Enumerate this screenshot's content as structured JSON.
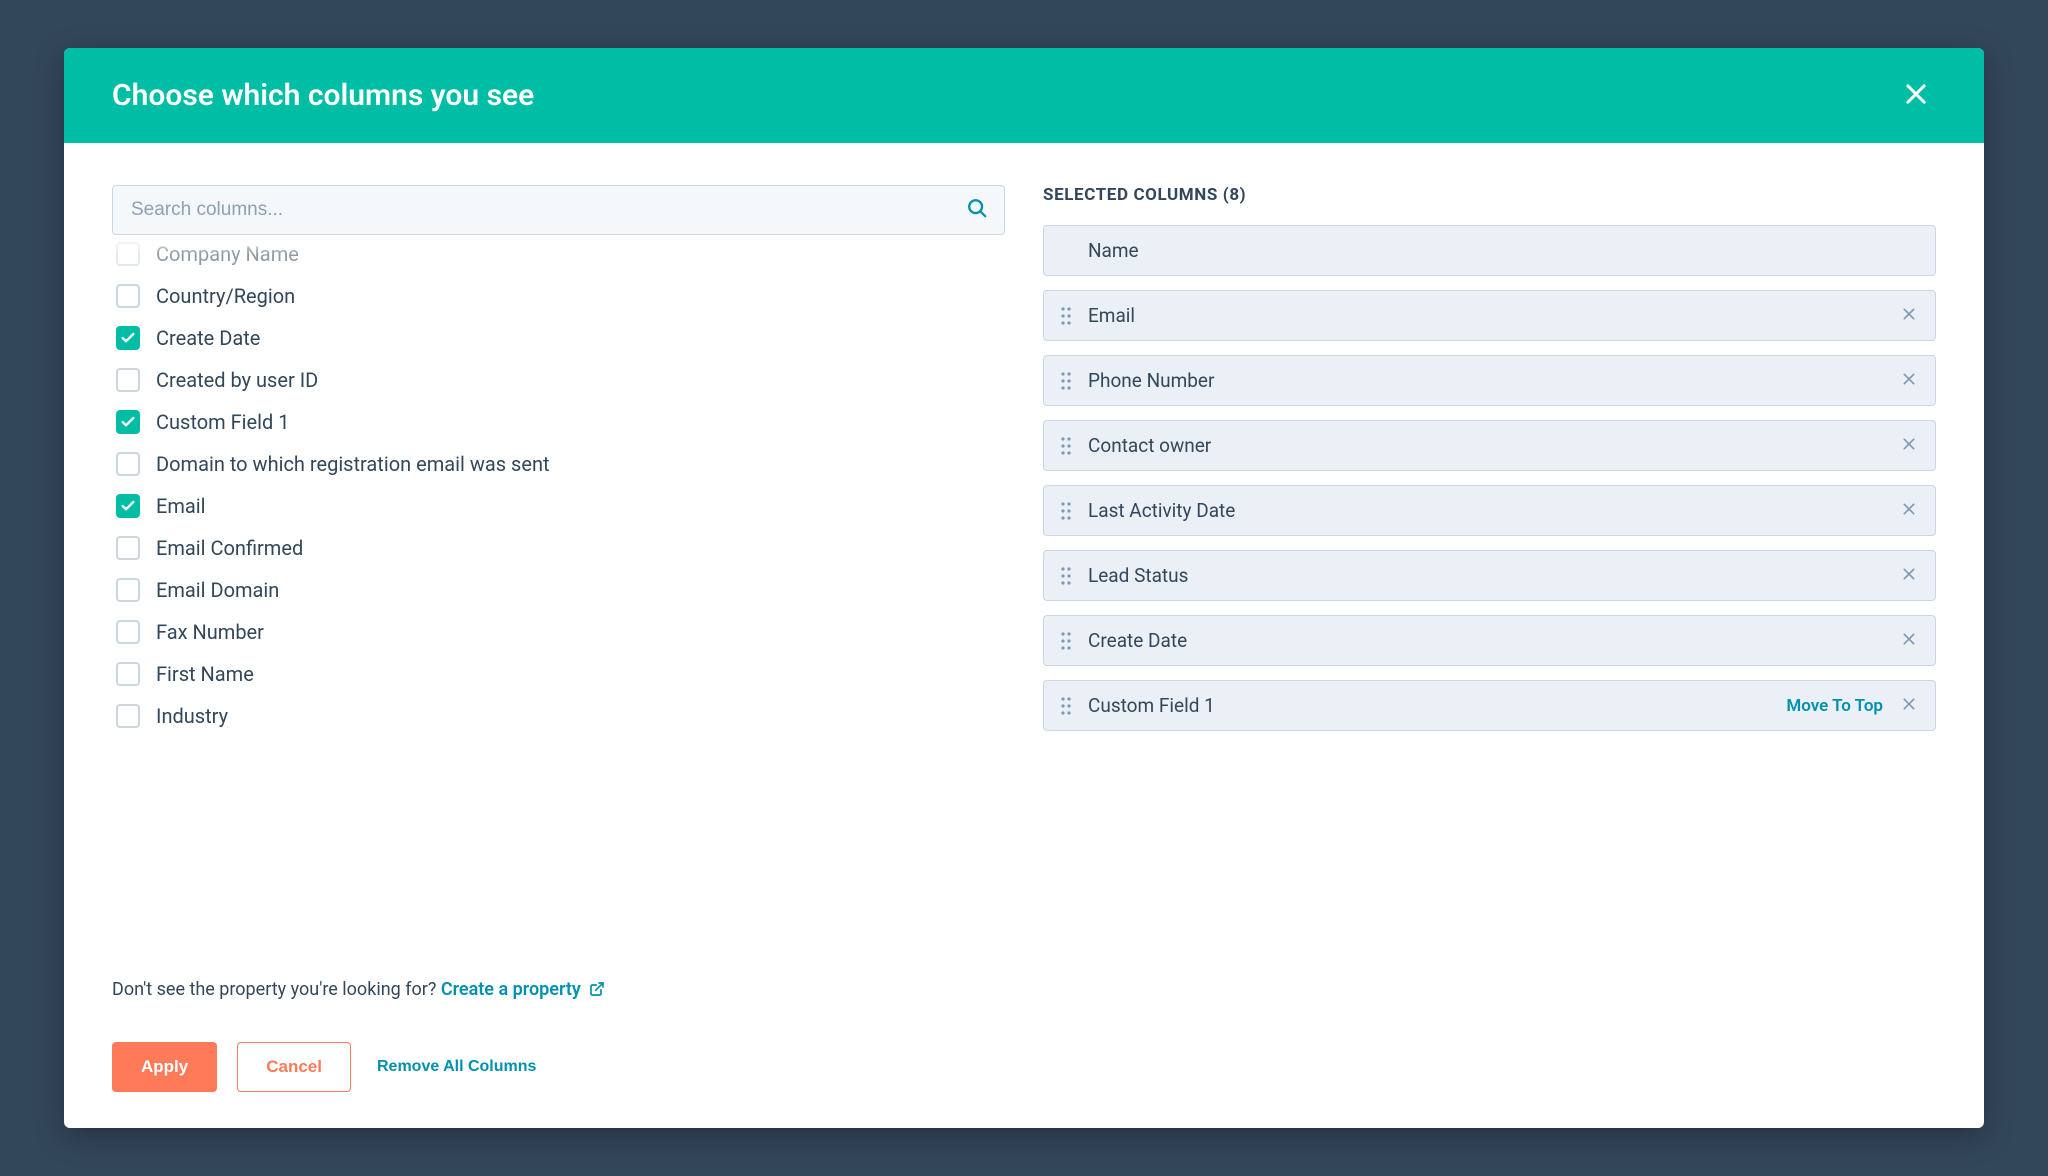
{
  "header": {
    "title": "Choose which columns you see"
  },
  "search": {
    "placeholder": "Search columns...",
    "value": ""
  },
  "available": [
    {
      "label": "Company Name",
      "checked": false,
      "faded": true
    },
    {
      "label": "Country/Region",
      "checked": false,
      "faded": false
    },
    {
      "label": "Create Date",
      "checked": true,
      "faded": false
    },
    {
      "label": "Created by user ID",
      "checked": false,
      "faded": false
    },
    {
      "label": "Custom Field 1",
      "checked": true,
      "faded": false
    },
    {
      "label": "Domain to which registration email was sent",
      "checked": false,
      "faded": false
    },
    {
      "label": "Email",
      "checked": true,
      "faded": false
    },
    {
      "label": "Email Confirmed",
      "checked": false,
      "faded": false
    },
    {
      "label": "Email Domain",
      "checked": false,
      "faded": false
    },
    {
      "label": "Fax Number",
      "checked": false,
      "faded": false
    },
    {
      "label": "First Name",
      "checked": false,
      "faded": false
    },
    {
      "label": "Industry",
      "checked": false,
      "faded": false
    }
  ],
  "helper": {
    "text": "Don't see the property you're looking for? ",
    "link": "Create a property"
  },
  "selected_header": "SELECTED COLUMNS (8)",
  "selected": [
    {
      "label": "Name",
      "locked": true,
      "removable": false,
      "move_to_top": false
    },
    {
      "label": "Email",
      "locked": false,
      "removable": true,
      "move_to_top": false
    },
    {
      "label": "Phone Number",
      "locked": false,
      "removable": true,
      "move_to_top": false
    },
    {
      "label": "Contact owner",
      "locked": false,
      "removable": true,
      "move_to_top": false
    },
    {
      "label": "Last Activity Date",
      "locked": false,
      "removable": true,
      "move_to_top": false
    },
    {
      "label": "Lead Status",
      "locked": false,
      "removable": true,
      "move_to_top": false
    },
    {
      "label": "Create Date",
      "locked": false,
      "removable": true,
      "move_to_top": false
    },
    {
      "label": "Custom Field 1",
      "locked": false,
      "removable": true,
      "move_to_top": true
    }
  ],
  "move_to_top_label": "Move To Top",
  "footer": {
    "apply": "Apply",
    "cancel": "Cancel",
    "remove_all": "Remove All Columns"
  }
}
